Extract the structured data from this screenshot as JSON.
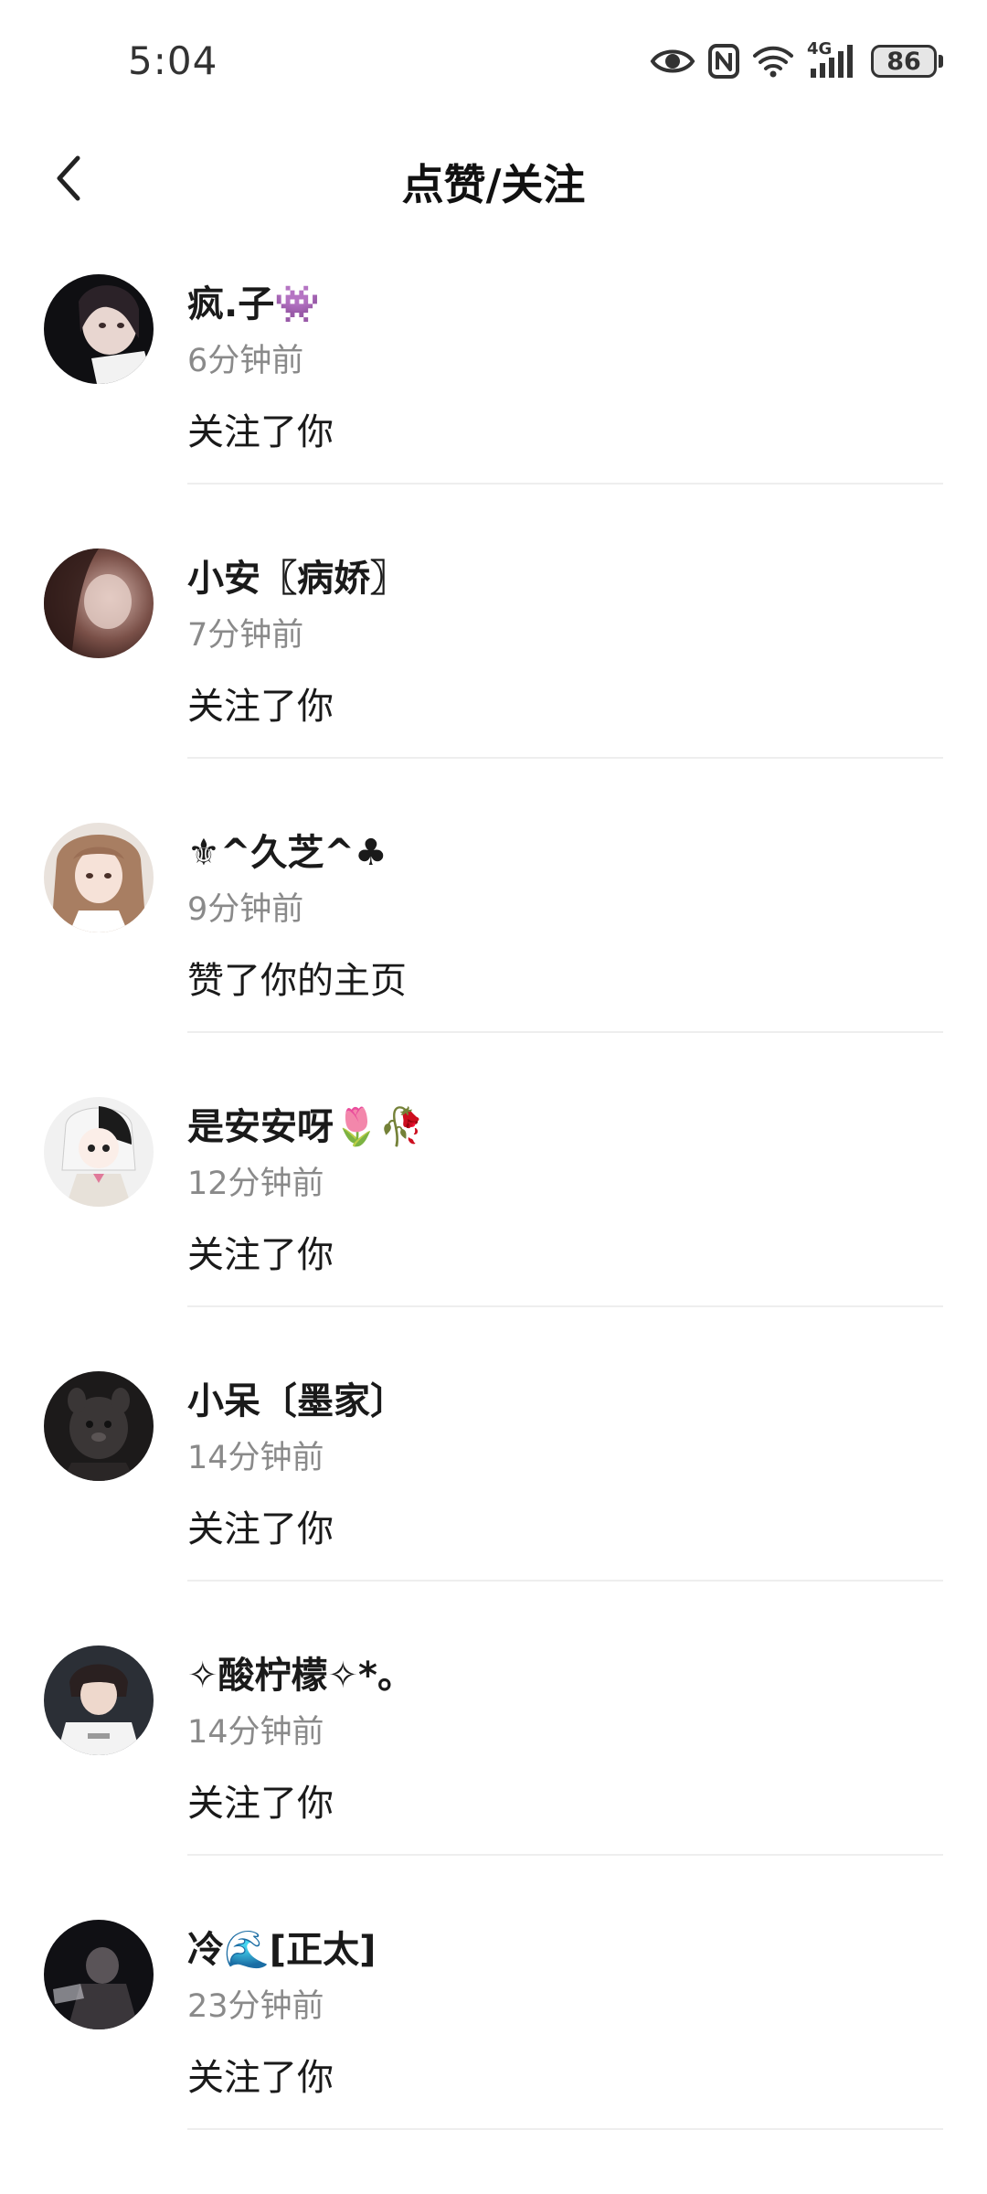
{
  "status_bar": {
    "time": "5:04",
    "network": "4G",
    "battery": "86",
    "icons": [
      "eye-icon",
      "nfc-icon",
      "wifi-icon",
      "signal-icon",
      "battery-icon"
    ]
  },
  "header": {
    "title": "点赞/关注",
    "back_icon": "chevron-left-icon"
  },
  "notifications": [
    {
      "name": "疯.子👾",
      "time": "6分钟前",
      "action": "关注了你"
    },
    {
      "name": "小安〖病娇〗",
      "time": "7分钟前",
      "action": "关注了你"
    },
    {
      "name": "⚜^久芝^♣",
      "time": "9分钟前",
      "action": "赞了你的主页"
    },
    {
      "name": "是安安呀🌷🥀",
      "time": "12分钟前",
      "action": "关注了你"
    },
    {
      "name": "小呆〔墨家〕",
      "time": "14分钟前",
      "action": "关注了你"
    },
    {
      "name": "✧酸柠檬✧*。",
      "time": "14分钟前",
      "action": "关注了你"
    },
    {
      "name": "冷🌊[正太]",
      "time": "23分钟前",
      "action": "关注了你"
    }
  ],
  "colors": {
    "text_primary": "#111111",
    "text_secondary": "#8a8a8a",
    "divider": "#eeeeee",
    "background": "#ffffff"
  }
}
